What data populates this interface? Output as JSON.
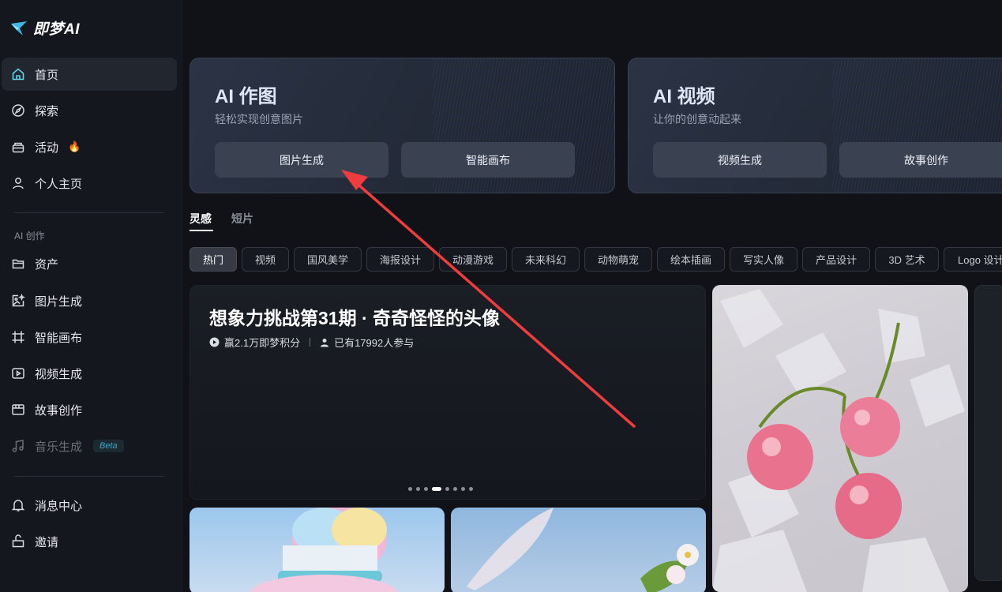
{
  "brand": {
    "name": "即梦AI"
  },
  "sidebar": {
    "main": [
      {
        "label": "首页",
        "icon": "home-icon",
        "active": true
      },
      {
        "label": "探索",
        "icon": "compass-icon"
      },
      {
        "label": "活动",
        "icon": "gift-icon",
        "badge": "🔥"
      },
      {
        "label": "个人主页",
        "icon": "user-icon"
      }
    ],
    "section_label": "AI 创作",
    "create": [
      {
        "label": "资产",
        "icon": "folder-icon"
      },
      {
        "label": "图片生成",
        "icon": "image-gen-icon"
      },
      {
        "label": "智能画布",
        "icon": "canvas-icon"
      },
      {
        "label": "视频生成",
        "icon": "video-icon"
      },
      {
        "label": "故事创作",
        "icon": "story-icon"
      },
      {
        "label": "音乐生成",
        "icon": "music-icon",
        "badge": "Beta",
        "disabled": true
      }
    ],
    "bottom": [
      {
        "label": "消息中心",
        "icon": "bell-icon"
      },
      {
        "label": "邀请",
        "icon": "invite-icon"
      }
    ]
  },
  "cards": [
    {
      "title": "AI 作图",
      "subtitle": "轻松实现创意图片",
      "buttons": [
        "图片生成",
        "智能画布"
      ]
    },
    {
      "title": "AI 视频",
      "subtitle": "让你的创意动起来",
      "buttons": [
        "视频生成",
        "故事创作"
      ]
    }
  ],
  "tabs": [
    "灵感",
    "短片"
  ],
  "chips": [
    "热门",
    "视频",
    "国风美学",
    "海报设计",
    "动漫游戏",
    "未来科幻",
    "动物萌宠",
    "绘本插画",
    "写实人像",
    "产品设计",
    "3D 艺术",
    "Logo 设计"
  ],
  "banner": {
    "title": "想象力挑战第31期 · 奇奇怪怪的头像",
    "reward": "赢2.1万即梦积分",
    "participants": "已有17992人参与",
    "carousel_total": 8,
    "carousel_active": 4
  },
  "colors": {
    "annotation_arrow": "#f03c3c",
    "accent": "#3aa6c9"
  }
}
